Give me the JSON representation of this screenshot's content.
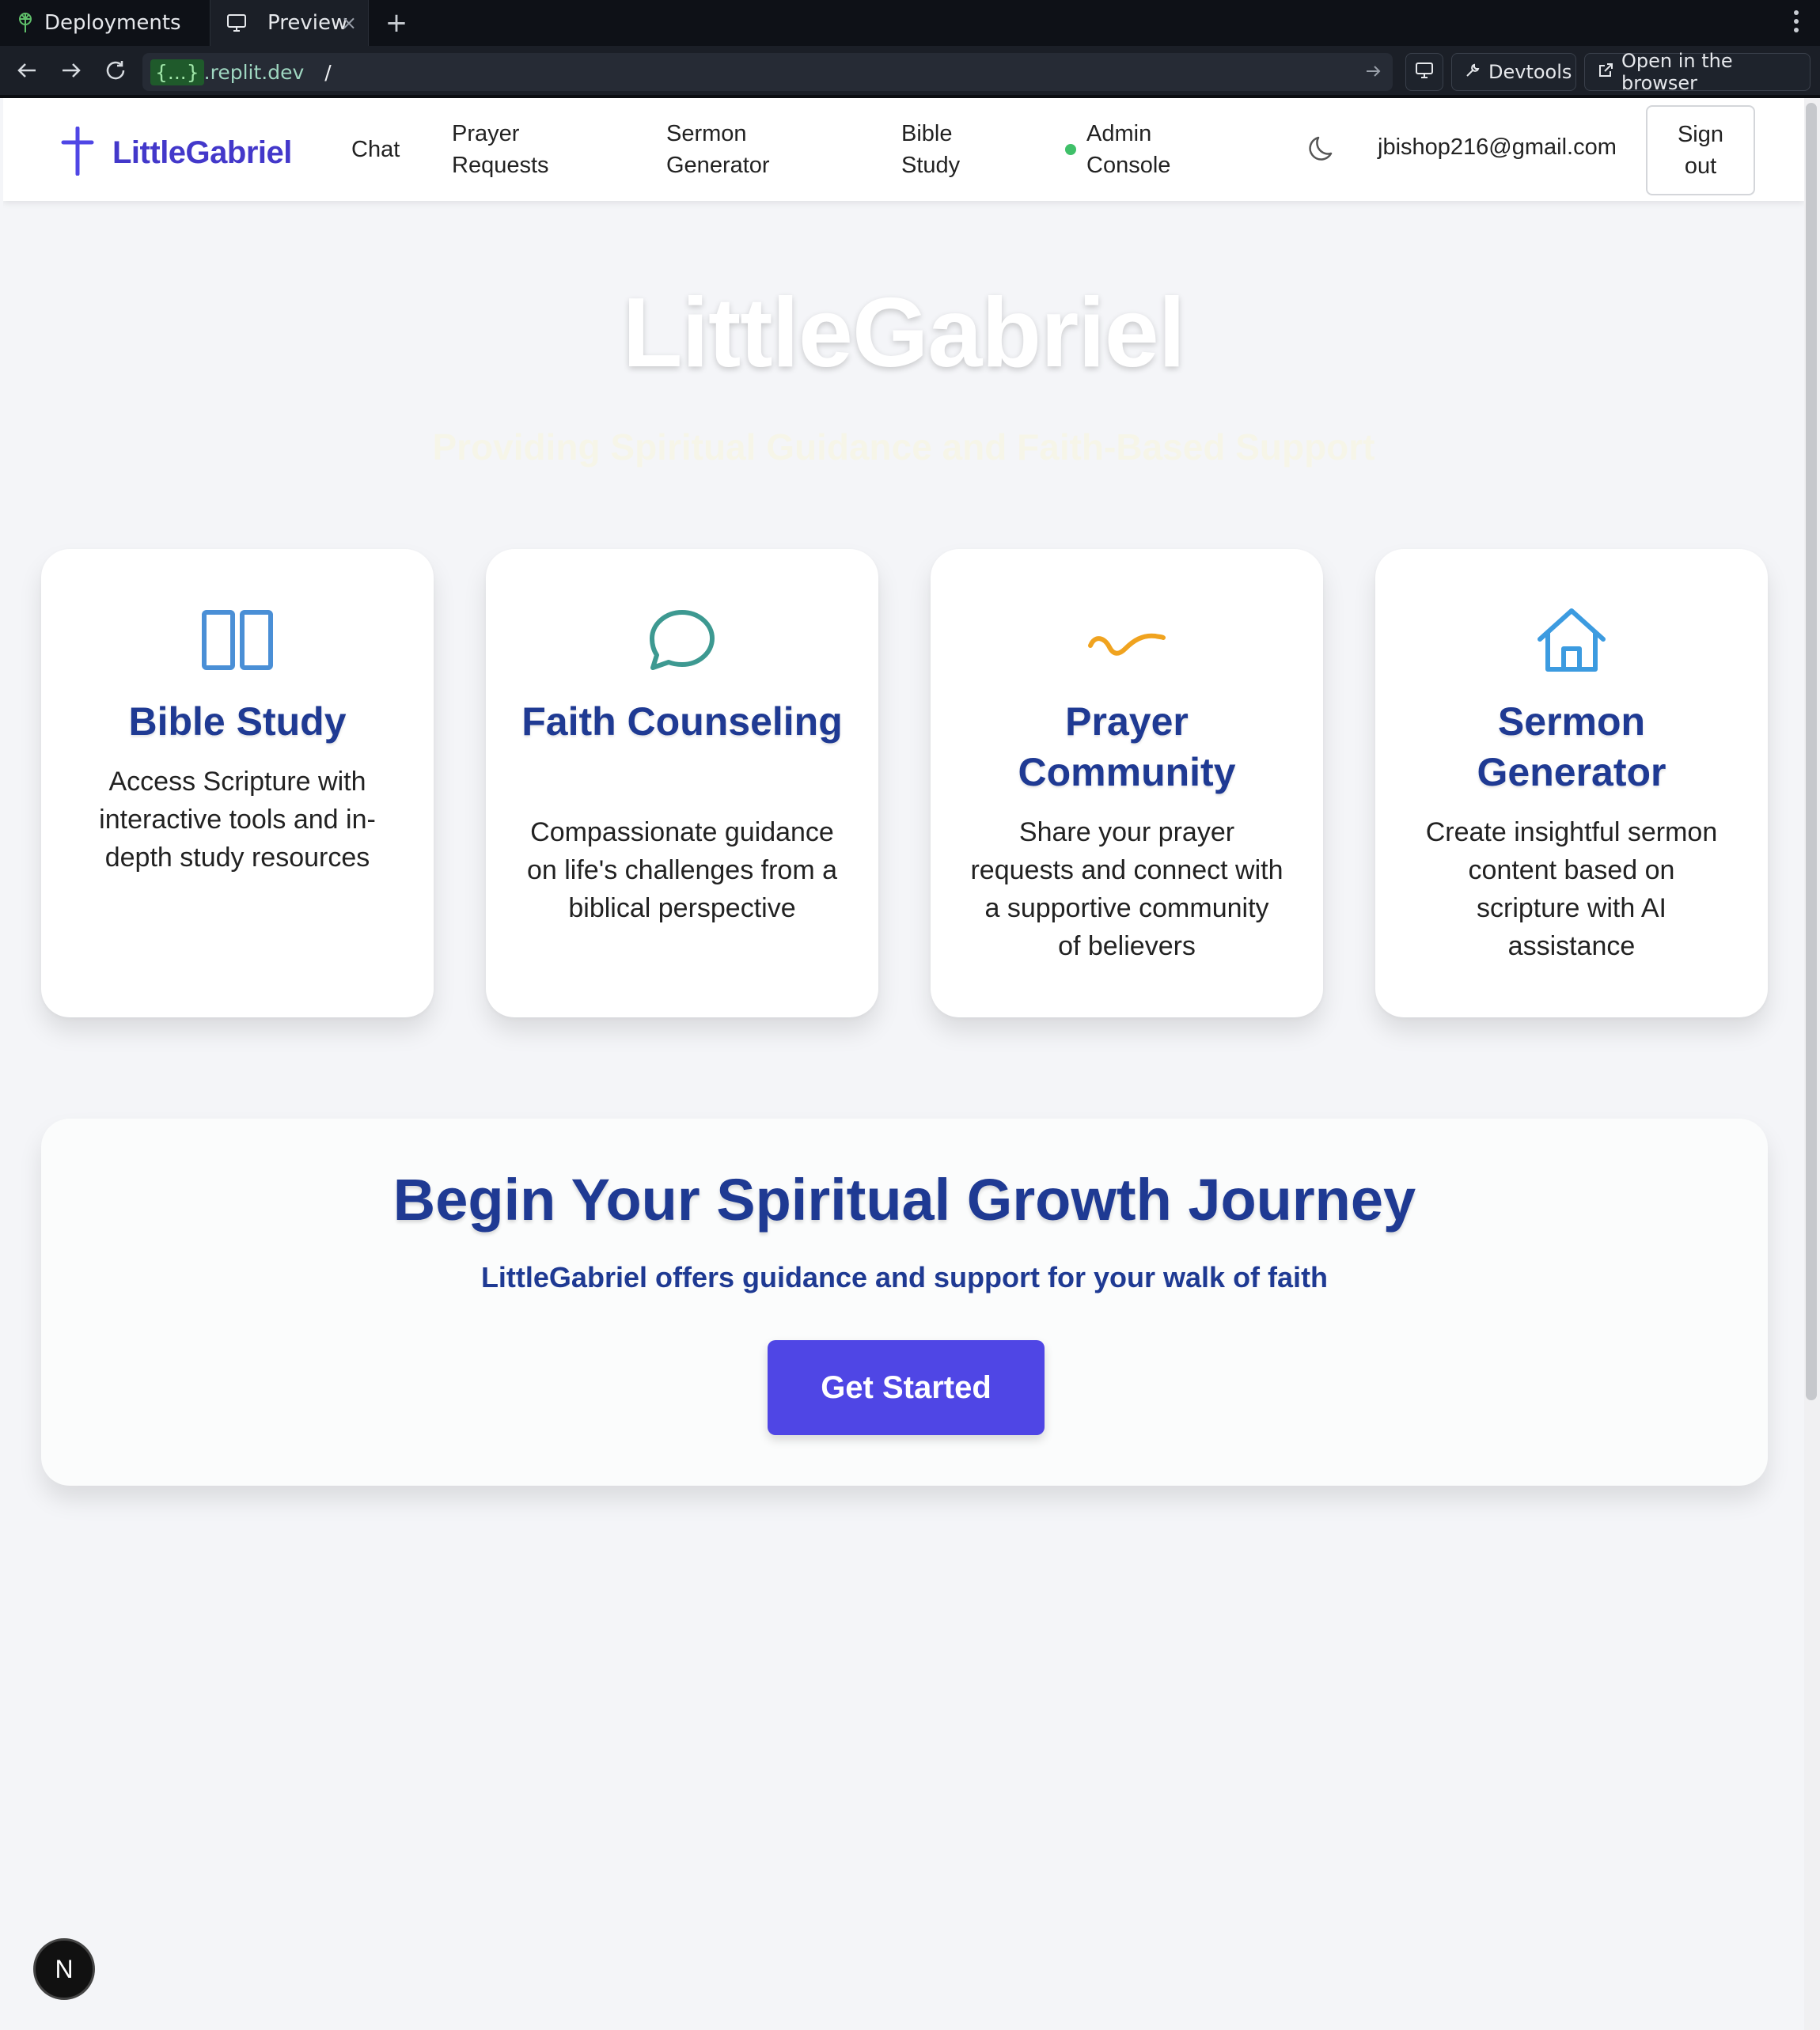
{
  "browser": {
    "tabs": [
      {
        "label": "Deployments",
        "icon": "deployments-icon"
      },
      {
        "label": "Preview",
        "icon": "monitor-icon",
        "close": "×"
      }
    ],
    "new_tab": "+",
    "menu": "⋮",
    "url_host_badge": "{...}",
    "url_host": ".replit.dev",
    "url_path": "/",
    "devtools_label": "Devtools",
    "open_browser_label": "Open in the browser"
  },
  "navbar": {
    "brand": "LittleGabriel",
    "links": {
      "chat": "Chat",
      "prayer_1": "Prayer",
      "prayer_2": "Requests",
      "sermon_1": "Sermon",
      "sermon_2": "Generator",
      "bible_1": "Bible",
      "bible_2": "Study",
      "admin_1": "Admin",
      "admin_2": "Console"
    },
    "email": "jbishop216@gmail.com",
    "signout_1": "Sign",
    "signout_2": "out",
    "colors": {
      "brand": "#4338ca",
      "online": "#3fc069"
    }
  },
  "hero": {
    "title": "LittleGabriel",
    "subtitle": "Providing Spiritual Guidance and Faith-Based Support"
  },
  "features": [
    {
      "icon": "book-icon",
      "title": "Bible Study",
      "description": "Access Scripture with interactive tools and in-depth study resources"
    },
    {
      "icon": "chat-bubble-icon",
      "title": "Faith Counseling",
      "description": "Compassionate guidance on life's challenges from a biblical perspective"
    },
    {
      "icon": "wave-icon",
      "title": "Prayer Community",
      "description": "Share your prayer requests and connect with a supportive community of believers"
    },
    {
      "icon": "home-icon",
      "title": "Sermon Generator",
      "description": "Create insightful sermon content based on scripture with AI assistance"
    }
  ],
  "cta": {
    "title": "Begin Your Spiritual Growth Journey",
    "subtitle": "LittleGabriel offers guidance and support for your walk of faith",
    "button": "Get Started",
    "button_color": "#4f46e5"
  },
  "badge": "N"
}
